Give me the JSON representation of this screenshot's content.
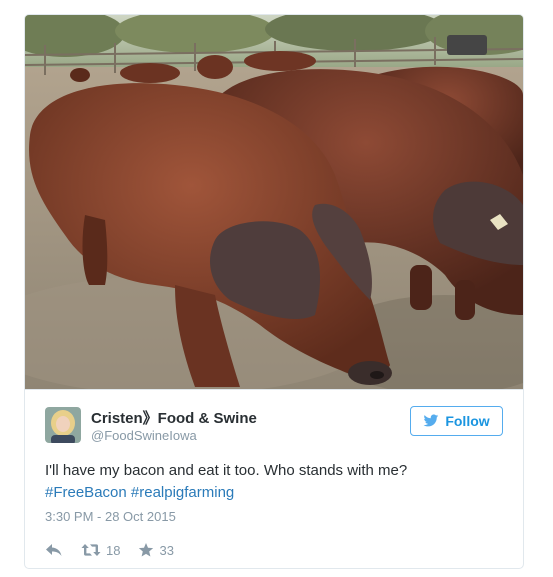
{
  "tweet": {
    "author_name": "Cristen》Food & Swine",
    "author_handle": "@FoodSwineIowa",
    "follow_label": "Follow",
    "text_main": "I'll have my bacon and eat it too. Who stands with me?",
    "hashtags": [
      "#FreeBacon",
      "#realpigfarming"
    ],
    "timestamp": "3:30 PM - 28 Oct 2015",
    "retweet_count": "18",
    "like_count": "33"
  },
  "colors": {
    "accent": "#55acee",
    "link": "#2b7bb9",
    "muted": "#8899a6",
    "text": "#292f33"
  },
  "icons": {
    "reply": "reply-icon",
    "retweet": "retweet-icon",
    "like": "star-icon",
    "follow": "twitter-bird-icon"
  }
}
